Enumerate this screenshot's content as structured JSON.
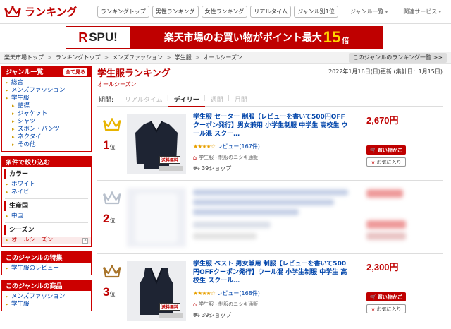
{
  "header": {
    "logo_text": "ランキング",
    "nav": [
      "ランキングトップ",
      "男性ランキング",
      "女性ランキング",
      "リアルタイム",
      "ジャンル別1位"
    ],
    "right": [
      "ジャンル一覧",
      "関連サービス"
    ]
  },
  "banner": {
    "left_r": "R",
    "left_text": "SPU!",
    "text_a": "楽天市場のお買い物がポイント最大",
    "big": "15",
    "unit": "倍"
  },
  "breadcrumb": {
    "items": [
      "楽天市場トップ",
      "ランキングトップ",
      "メンズファッション",
      "学生服",
      "オールシーズン"
    ],
    "list_button": "このジャンルのランキング一覧 >>"
  },
  "sidebar": {
    "genre_title": "ジャンル一覧",
    "all_button": "全て見る",
    "genre_items": [
      {
        "label": "総合",
        "sub": false
      },
      {
        "label": "メンズファッション",
        "sub": false
      },
      {
        "label": "学生服",
        "sub": false
      },
      {
        "label": "詰襟",
        "sub": true
      },
      {
        "label": "ジャケット",
        "sub": true
      },
      {
        "label": "シャツ",
        "sub": true
      },
      {
        "label": "ズボン・パンツ",
        "sub": true
      },
      {
        "label": "ネクタイ",
        "sub": true
      },
      {
        "label": "その他",
        "sub": true
      }
    ],
    "filter_title": "条件で絞り込む",
    "color_label": "カラー",
    "color_items": [
      "ホワイト",
      "ネイビー"
    ],
    "origin_label": "生産国",
    "origin_items": [
      "中国"
    ],
    "season_label": "シーズン",
    "season_selected": "オールシーズン",
    "feature_title": "このジャンルの特集",
    "feature_items": [
      "学生服のレビュー"
    ],
    "products_title": "このジャンルの商品",
    "products_items": [
      "メンズファッション",
      "学生服"
    ]
  },
  "main": {
    "title": "学生服ランキング",
    "subtitle": "オールシーズン",
    "update": "2022年1月16日(日)更新 (集計日：1月15日)",
    "period_label": "期間:",
    "period_tabs": [
      "リアルタイム",
      "デイリー",
      "週間",
      "月間"
    ],
    "period_active": "デイリー"
  },
  "items": [
    {
      "rank": "1",
      "rank_suffix": "位",
      "name": "学生服 セーター 制服【レビューを書いて500円OFFクーポン発行】男女兼用 小学生制服 中学生 高校生 ウール混 スクー…",
      "stars": "★★★★☆",
      "review": "レビュー(167件)",
      "shop": "学生服・制服のニシキ通販",
      "ship": "39ショップ",
      "price": "2,670円",
      "free_label": "送料無料"
    },
    {
      "rank": "2",
      "rank_suffix": "位"
    },
    {
      "rank": "3",
      "rank_suffix": "位",
      "name": "学生服 ベスト 男女兼用 制服【レビューを書いて500円OFFクーポン発行】ウール混 小学生制服 中学生 高校生 スクール…",
      "stars": "★★★★☆",
      "review": "レビュー(168件)",
      "shop": "学生服・制服のニシキ通販",
      "ship": "39ショップ",
      "price": "2,300円",
      "free_label": "送料無料"
    }
  ],
  "buttons": {
    "buy": "買い物かご",
    "fav": "お気に入り"
  },
  "colors": {
    "accent": "#bf0000",
    "gold": "#e8b400",
    "silver": "#b8c0cc",
    "bronze": "#a8742a"
  }
}
